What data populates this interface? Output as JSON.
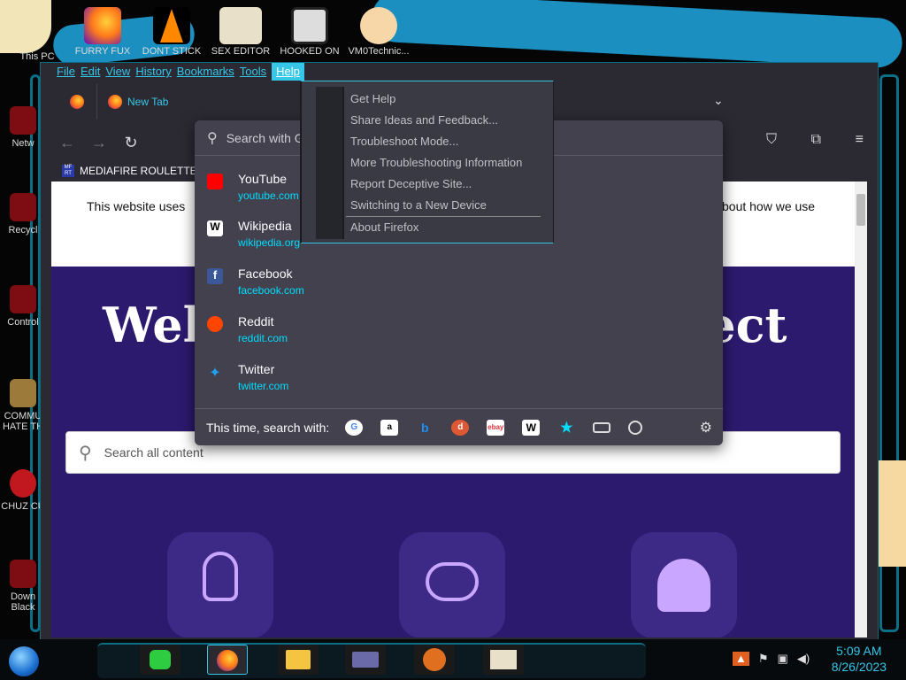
{
  "desktop": {
    "top_icons": [
      {
        "label": "This PC"
      },
      {
        "label": "FURRY FUX"
      },
      {
        "label": "DONT STICK"
      },
      {
        "label": "SEX EDITOR"
      },
      {
        "label": "HOOKED ON"
      },
      {
        "label": "VM0Technic..."
      }
    ],
    "left_icons": [
      {
        "label": "Netw"
      },
      {
        "label": "Recycl"
      },
      {
        "label": "Control"
      },
      {
        "label": "COMMU HATE TH"
      },
      {
        "label": "CHUZ CU"
      },
      {
        "label": "Down Black"
      }
    ]
  },
  "menubar": {
    "items": [
      "File",
      "Edit",
      "View",
      "History",
      "Bookmarks",
      "Tools",
      "Help"
    ],
    "active": "Help"
  },
  "tabs": [
    {
      "label": "New Tab"
    }
  ],
  "bookmarks_bar": {
    "items": [
      {
        "label": "MEDIAFIRE ROULETTER",
        "badge": "MF RT"
      }
    ]
  },
  "page": {
    "cookie_left": "This website uses",
    "cookie_right": "bout how we use",
    "hero_left": "Welc",
    "hero_right": "nect",
    "search_placeholder": "Search all content"
  },
  "url_dropdown": {
    "placeholder": "Search with G",
    "top_sites": [
      {
        "name": "YouTube",
        "url": "youtube.com",
        "icon": "youtube-icon",
        "color": "#ff0000"
      },
      {
        "name": "Wikipedia",
        "url": "wikipedia.org",
        "icon": "wikipedia-icon",
        "color": "#ffffff"
      },
      {
        "name": "Facebook",
        "url": "facebook.com",
        "icon": "facebook-icon",
        "color": "#3b5998"
      },
      {
        "name": "Reddit",
        "url": "reddit.com",
        "icon": "reddit-icon",
        "color": "#ff4500"
      },
      {
        "name": "Twitter",
        "url": "twitter.com",
        "icon": "twitter-icon",
        "color": "#1da1f2"
      }
    ],
    "engines_label": "This time, search with:",
    "engines": [
      "google-icon",
      "amazon-icon",
      "bing-icon",
      "duckduckgo-icon",
      "ebay-icon",
      "wikipedia-icon",
      "bookmarks-icon",
      "tabs-icon",
      "history-icon"
    ]
  },
  "help_menu": {
    "items": [
      "Get Help",
      "Share Ideas and Feedback...",
      "Troubleshoot Mode...",
      "More Troubleshooting Information",
      "Report Deceptive Site...",
      "Switching to a New Device",
      "About Firefox"
    ]
  },
  "taskbar": {
    "time": "5:09 AM",
    "date": "8/26/2023"
  },
  "colors": {
    "accent": "#35c6e8",
    "panel": "#42414d",
    "hero": "#2c1a6e"
  }
}
